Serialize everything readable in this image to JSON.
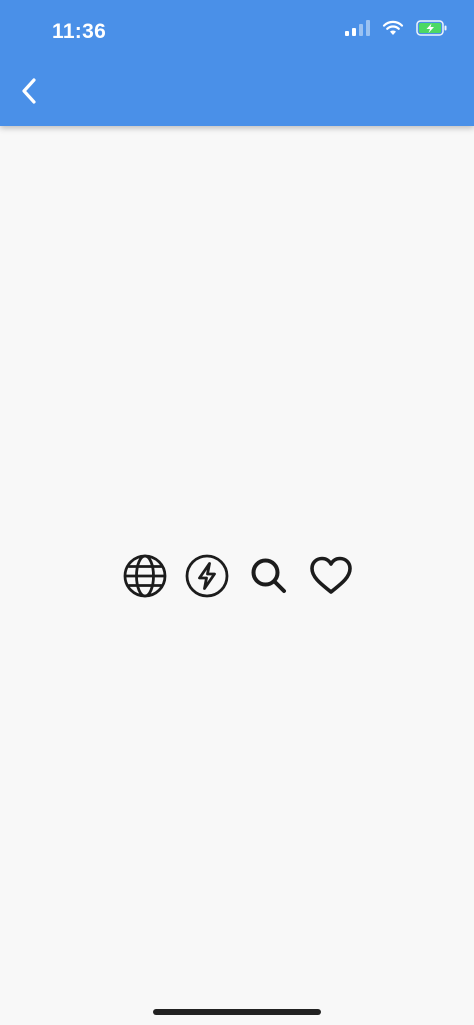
{
  "status_bar": {
    "time": "11:36",
    "signal_icon": "cellular-signal-icon",
    "wifi_icon": "wifi-icon",
    "battery_icon": "battery-charging-icon",
    "battery_color": "#4cd964"
  },
  "app_bar": {
    "color": "#4a90e8",
    "back_icon": "chevron-left-icon"
  },
  "icons": [
    "globe-icon",
    "flash-icon",
    "search-icon",
    "heart-icon"
  ]
}
